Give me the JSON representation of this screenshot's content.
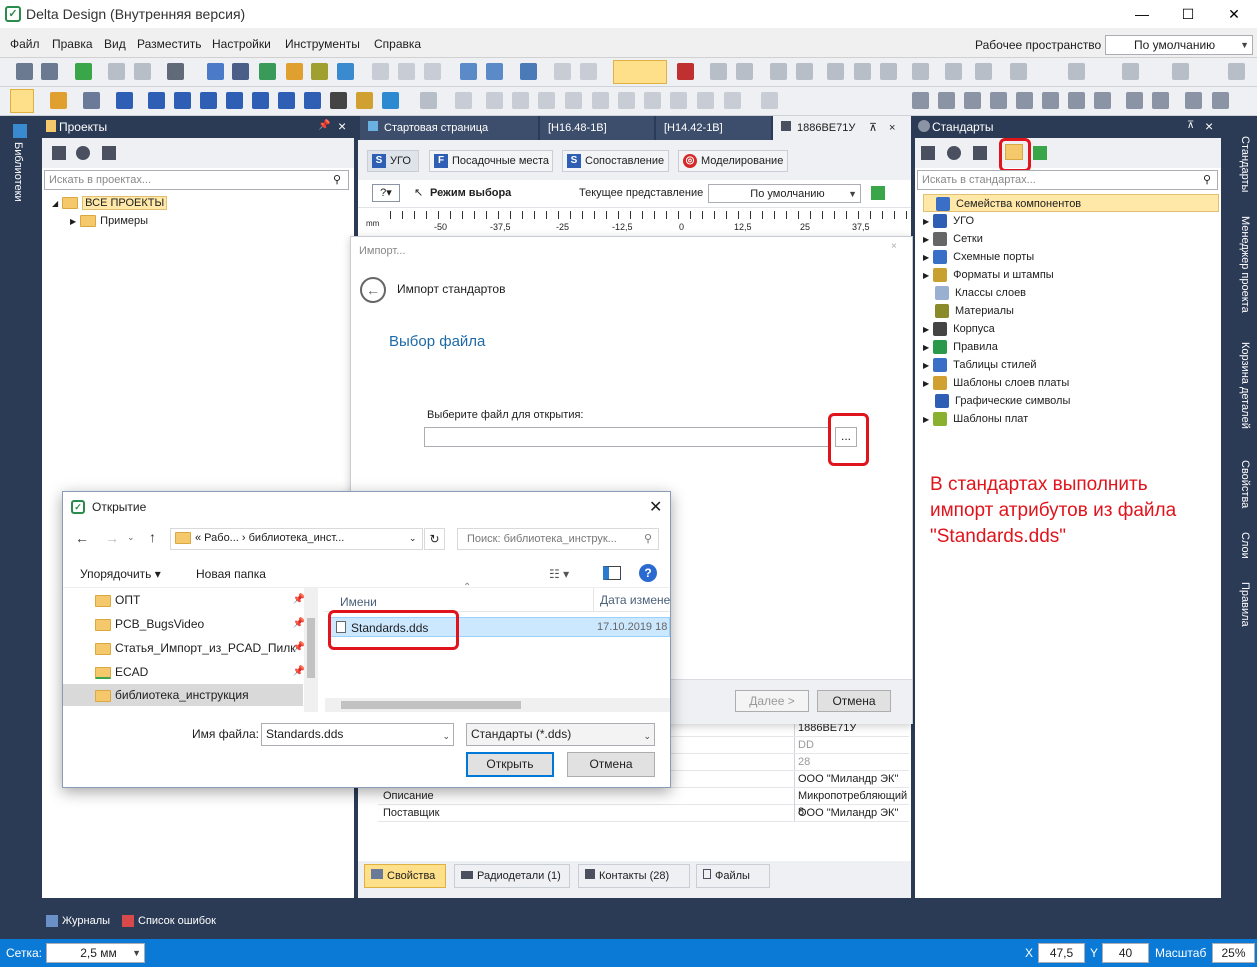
{
  "window": {
    "title": "Delta Design (Внутренняя версия)",
    "min": "—",
    "max": "☐",
    "close": "✕"
  },
  "menu": {
    "items": [
      "Файл",
      "Правка",
      "Вид",
      "Разместить",
      "Настройки",
      "Инструменты",
      "Справка"
    ],
    "workspace_label": "Рабочее пространство",
    "workspace_value": "По умолчанию"
  },
  "left_strip": {
    "label": "Библиотеки"
  },
  "projects": {
    "title": "Проекты",
    "search_placeholder": "Искать в проектах...",
    "tree": [
      {
        "label": "ВСЕ ПРОЕКТЫ",
        "selected": true
      },
      {
        "label": "Примеры",
        "selected": false
      }
    ]
  },
  "docs": {
    "tabs": [
      {
        "label": "Стартовая страница"
      },
      {
        "label": "[H16.48-1B]"
      },
      {
        "label": "[H14.42-1B]"
      },
      {
        "label": "1886BE71У"
      }
    ],
    "subtabs": [
      {
        "label": "УГО",
        "icon": "S",
        "color": "#2e5fb5"
      },
      {
        "label": "Посадочные места",
        "icon": "F",
        "color": "#2e5fb5"
      },
      {
        "label": "Сопоставление",
        "icon": "S",
        "color": "#2e5fb5"
      },
      {
        "label": "Моделирование",
        "icon": "◎",
        "color": "#d42a2a"
      }
    ],
    "mode_label": "Режим выбора",
    "view_label": "Текущее представление",
    "view_value": "По умолчанию",
    "ruler_unit": "mm",
    "ruler_ticks": [
      "-50",
      "-37,5",
      "-25",
      "-12,5",
      "0",
      "12,5",
      "25",
      "37,5"
    ]
  },
  "import_dialog": {
    "title": "Импорт...",
    "heading": "Импорт стандартов",
    "step": "Выбор файла",
    "file_label": "Выберите файл для открытия:",
    "browse": "...",
    "next": "Далее >",
    "cancel": "Отмена"
  },
  "properties": {
    "rows": [
      {
        "name": "",
        "value": "1886ВЕ71У"
      },
      {
        "name": "",
        "value": "DD"
      },
      {
        "name": "",
        "value": "28"
      },
      {
        "name": "",
        "value": "ООО \"Миландр ЭК\""
      },
      {
        "name": "Описание",
        "value": "Микропотребляющий 8"
      },
      {
        "name": "Поставщик",
        "value": "ООО \"Миландр ЭК\""
      }
    ],
    "bottom_tabs": [
      {
        "label": "Свойства"
      },
      {
        "label": "Радиодетали (1)"
      },
      {
        "label": "Контакты (28)"
      },
      {
        "label": "Файлы"
      }
    ]
  },
  "standards": {
    "title": "Стандарты",
    "search_placeholder": "Искать в стандартах...",
    "items": [
      {
        "label": "Семейства компонентов",
        "color": "#3a6fc7",
        "selected": true
      },
      {
        "label": "УГО",
        "color": "#2e5fb5",
        "selected": false
      },
      {
        "label": "Сетки",
        "color": "#666666",
        "selected": false
      },
      {
        "label": "Схемные порты",
        "color": "#3a6fc7",
        "selected": false
      },
      {
        "label": "Форматы и штампы",
        "color": "#c8a030",
        "selected": false
      },
      {
        "label": "Классы слоев",
        "color": "#9ab0d0",
        "selected": false
      },
      {
        "label": "Материалы",
        "color": "#8a8a2a",
        "selected": false
      },
      {
        "label": "Корпуса",
        "color": "#444444",
        "selected": false
      },
      {
        "label": "Правила",
        "color": "#2a9a4a",
        "selected": false
      },
      {
        "label": "Таблицы стилей",
        "color": "#3a6fc7",
        "selected": false
      },
      {
        "label": "Шаблоны слоев платы",
        "color": "#d0a030",
        "selected": false
      },
      {
        "label": "Графические символы",
        "color": "#2e5fb5",
        "selected": false
      },
      {
        "label": "Шаблоны плат",
        "color": "#8ab030",
        "selected": false
      }
    ],
    "annotation": "В стандартах выполнить импорт атрибутов из файла \"Standards.dds\"",
    "annotation_color": "#e0141c"
  },
  "right_strip": {
    "labels": [
      "Стандарты",
      "Менеджер проекта",
      "Корзина деталей",
      "Свойства",
      "Слои",
      "Правила"
    ]
  },
  "open_dialog": {
    "title": "Открытие",
    "path": "«  Рабо...  ›  библиотека_инст...",
    "search_placeholder": "Поиск: библиотека_инструк...",
    "organize": "Упорядочить ▾",
    "new_folder": "Новая папка",
    "nav": [
      {
        "label": "ОПТ"
      },
      {
        "label": "PCB_BugsVideo"
      },
      {
        "label": "Статья_Импорт_из_PCAD_Пилк"
      },
      {
        "label": "ECAD"
      },
      {
        "label": "библиотека_инструкция"
      }
    ],
    "col_name": "Имени",
    "col_date": "Дата изменен",
    "files": [
      {
        "name": "Standards.dds",
        "date": "17.10.2019 18"
      }
    ],
    "filename_label": "Имя файла:",
    "filename_value": "Standards.dds",
    "filetype": "Стандарты  (*.dds)",
    "open": "Открыть",
    "cancel": "Отмена"
  },
  "bottom_left_tabs": [
    {
      "label": "Журналы"
    },
    {
      "label": "Список ошибок"
    }
  ],
  "status": {
    "grid_label": "Сетка:",
    "grid_value": "2,5 мм",
    "x_label": "X",
    "x_value": "47,5",
    "y_label": "Y",
    "y_value": "40",
    "scale_label": "Масштаб",
    "scale_value": "25%"
  }
}
